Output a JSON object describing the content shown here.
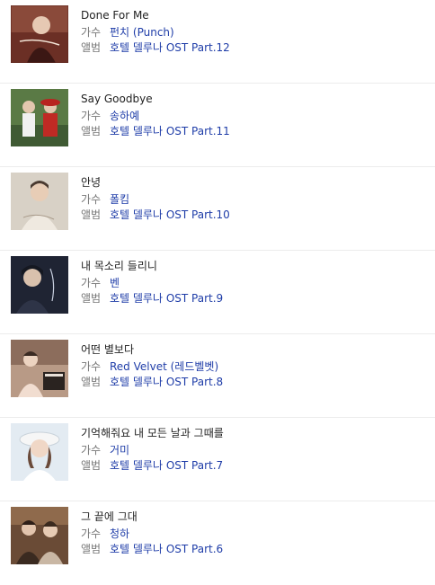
{
  "labels": {
    "artist": "가수",
    "album": "앨범"
  },
  "songs": [
    {
      "title": "Done For Me",
      "artist": "펀치 (Punch)",
      "album": "호텔 델루나 OST Part.12"
    },
    {
      "title": "Say Goodbye",
      "artist": "송하예",
      "album": "호텔 델루나 OST Part.11"
    },
    {
      "title": "안녕",
      "artist": "폴킴",
      "album": "호텔 델루나 OST Part.10"
    },
    {
      "title": "내 목소리 들리니",
      "artist": "벤",
      "album": "호텔 델루나 OST Part.9"
    },
    {
      "title": "어떤 별보다",
      "artist": "Red Velvet (레드벨벳)",
      "album": "호텔 델루나 OST Part.8"
    },
    {
      "title": "기억해줘요 내 모든 날과 그때를",
      "artist": "거미",
      "album": "호텔 델루나 OST Part.7"
    },
    {
      "title": "그 끝에 그대",
      "artist": "청하",
      "album": "호텔 델루나 OST Part.6"
    }
  ],
  "colors": {
    "link": "#1f3da8",
    "label": "#777777",
    "separator": "#ececec"
  }
}
